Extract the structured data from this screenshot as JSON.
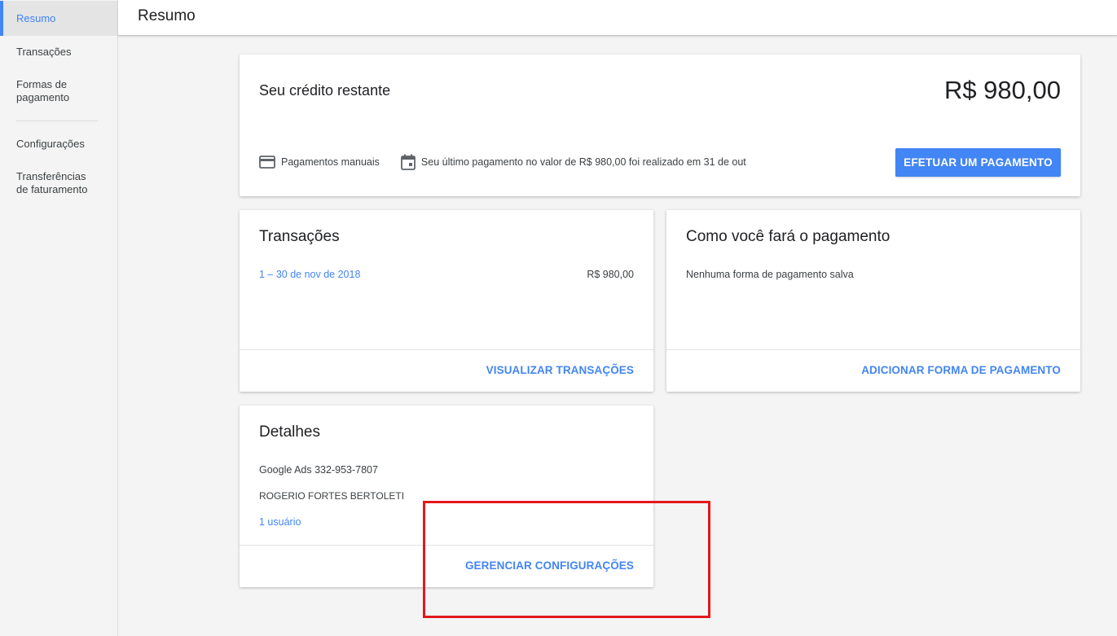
{
  "sidebar": {
    "items": [
      {
        "label": "Resumo",
        "active": true
      },
      {
        "label": "Transações"
      },
      {
        "label": "Formas de pagamento"
      },
      {
        "label": "Configurações"
      },
      {
        "label": "Transferências de faturamento"
      }
    ]
  },
  "header": {
    "title": "Resumo"
  },
  "credit_card": {
    "title": "Seu crédito restante",
    "amount": "R$ 980,00",
    "payment_type": "Pagamentos manuais",
    "last_payment": "Seu último pagamento no valor de R$ 980,00 foi realizado em 31 de out",
    "button": "EFETUAR UM PAGAMENTO"
  },
  "transactions_card": {
    "title": "Transações",
    "period": "1 – 30 de nov de 2018",
    "amount": "R$ 980,00",
    "footer_link": "VISUALIZAR TRANSAÇÕES"
  },
  "payment_card": {
    "title": "Como você fará o pagamento",
    "message": "Nenhuma forma de pagamento salva",
    "footer_link": "ADICIONAR FORMA DE PAGAMENTO"
  },
  "details_card": {
    "title": "Detalhes",
    "account": "Google Ads 332-953-7807",
    "name": "ROGERIO FORTES BERTOLETI",
    "users_link": "1 usuário",
    "footer_link": "GERENCIAR CONFIGURAÇÕES"
  },
  "colors": {
    "accent": "#4285f4",
    "highlight_box": "#e3181c"
  },
  "icons": {
    "payment_type": "credit-card-icon",
    "last_payment": "calendar-icon"
  }
}
